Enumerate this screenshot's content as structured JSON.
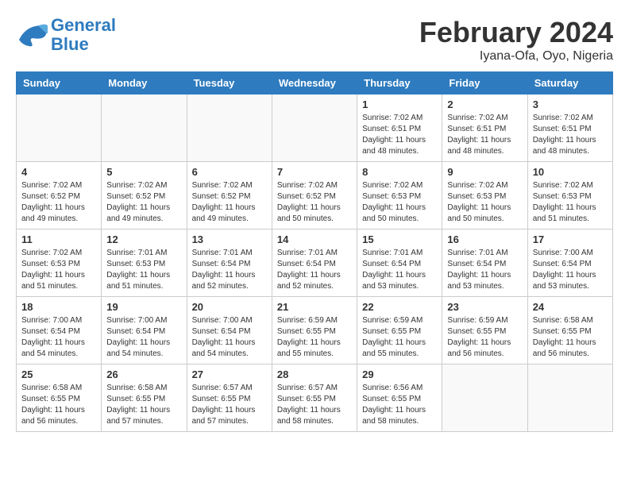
{
  "logo": {
    "general": "General",
    "blue": "Blue"
  },
  "title": "February 2024",
  "subtitle": "Iyana-Ofa, Oyo, Nigeria",
  "days_of_week": [
    "Sunday",
    "Monday",
    "Tuesday",
    "Wednesday",
    "Thursday",
    "Friday",
    "Saturday"
  ],
  "weeks": [
    [
      {
        "day": "",
        "info": ""
      },
      {
        "day": "",
        "info": ""
      },
      {
        "day": "",
        "info": ""
      },
      {
        "day": "",
        "info": ""
      },
      {
        "day": "1",
        "info": "Sunrise: 7:02 AM\nSunset: 6:51 PM\nDaylight: 11 hours\nand 48 minutes."
      },
      {
        "day": "2",
        "info": "Sunrise: 7:02 AM\nSunset: 6:51 PM\nDaylight: 11 hours\nand 48 minutes."
      },
      {
        "day": "3",
        "info": "Sunrise: 7:02 AM\nSunset: 6:51 PM\nDaylight: 11 hours\nand 48 minutes."
      }
    ],
    [
      {
        "day": "4",
        "info": "Sunrise: 7:02 AM\nSunset: 6:52 PM\nDaylight: 11 hours\nand 49 minutes."
      },
      {
        "day": "5",
        "info": "Sunrise: 7:02 AM\nSunset: 6:52 PM\nDaylight: 11 hours\nand 49 minutes."
      },
      {
        "day": "6",
        "info": "Sunrise: 7:02 AM\nSunset: 6:52 PM\nDaylight: 11 hours\nand 49 minutes."
      },
      {
        "day": "7",
        "info": "Sunrise: 7:02 AM\nSunset: 6:52 PM\nDaylight: 11 hours\nand 50 minutes."
      },
      {
        "day": "8",
        "info": "Sunrise: 7:02 AM\nSunset: 6:53 PM\nDaylight: 11 hours\nand 50 minutes."
      },
      {
        "day": "9",
        "info": "Sunrise: 7:02 AM\nSunset: 6:53 PM\nDaylight: 11 hours\nand 50 minutes."
      },
      {
        "day": "10",
        "info": "Sunrise: 7:02 AM\nSunset: 6:53 PM\nDaylight: 11 hours\nand 51 minutes."
      }
    ],
    [
      {
        "day": "11",
        "info": "Sunrise: 7:02 AM\nSunset: 6:53 PM\nDaylight: 11 hours\nand 51 minutes."
      },
      {
        "day": "12",
        "info": "Sunrise: 7:01 AM\nSunset: 6:53 PM\nDaylight: 11 hours\nand 51 minutes."
      },
      {
        "day": "13",
        "info": "Sunrise: 7:01 AM\nSunset: 6:54 PM\nDaylight: 11 hours\nand 52 minutes."
      },
      {
        "day": "14",
        "info": "Sunrise: 7:01 AM\nSunset: 6:54 PM\nDaylight: 11 hours\nand 52 minutes."
      },
      {
        "day": "15",
        "info": "Sunrise: 7:01 AM\nSunset: 6:54 PM\nDaylight: 11 hours\nand 53 minutes."
      },
      {
        "day": "16",
        "info": "Sunrise: 7:01 AM\nSunset: 6:54 PM\nDaylight: 11 hours\nand 53 minutes."
      },
      {
        "day": "17",
        "info": "Sunrise: 7:00 AM\nSunset: 6:54 PM\nDaylight: 11 hours\nand 53 minutes."
      }
    ],
    [
      {
        "day": "18",
        "info": "Sunrise: 7:00 AM\nSunset: 6:54 PM\nDaylight: 11 hours\nand 54 minutes."
      },
      {
        "day": "19",
        "info": "Sunrise: 7:00 AM\nSunset: 6:54 PM\nDaylight: 11 hours\nand 54 minutes."
      },
      {
        "day": "20",
        "info": "Sunrise: 7:00 AM\nSunset: 6:54 PM\nDaylight: 11 hours\nand 54 minutes."
      },
      {
        "day": "21",
        "info": "Sunrise: 6:59 AM\nSunset: 6:55 PM\nDaylight: 11 hours\nand 55 minutes."
      },
      {
        "day": "22",
        "info": "Sunrise: 6:59 AM\nSunset: 6:55 PM\nDaylight: 11 hours\nand 55 minutes."
      },
      {
        "day": "23",
        "info": "Sunrise: 6:59 AM\nSunset: 6:55 PM\nDaylight: 11 hours\nand 56 minutes."
      },
      {
        "day": "24",
        "info": "Sunrise: 6:58 AM\nSunset: 6:55 PM\nDaylight: 11 hours\nand 56 minutes."
      }
    ],
    [
      {
        "day": "25",
        "info": "Sunrise: 6:58 AM\nSunset: 6:55 PM\nDaylight: 11 hours\nand 56 minutes."
      },
      {
        "day": "26",
        "info": "Sunrise: 6:58 AM\nSunset: 6:55 PM\nDaylight: 11 hours\nand 57 minutes."
      },
      {
        "day": "27",
        "info": "Sunrise: 6:57 AM\nSunset: 6:55 PM\nDaylight: 11 hours\nand 57 minutes."
      },
      {
        "day": "28",
        "info": "Sunrise: 6:57 AM\nSunset: 6:55 PM\nDaylight: 11 hours\nand 58 minutes."
      },
      {
        "day": "29",
        "info": "Sunrise: 6:56 AM\nSunset: 6:55 PM\nDaylight: 11 hours\nand 58 minutes."
      },
      {
        "day": "",
        "info": ""
      },
      {
        "day": "",
        "info": ""
      }
    ]
  ]
}
